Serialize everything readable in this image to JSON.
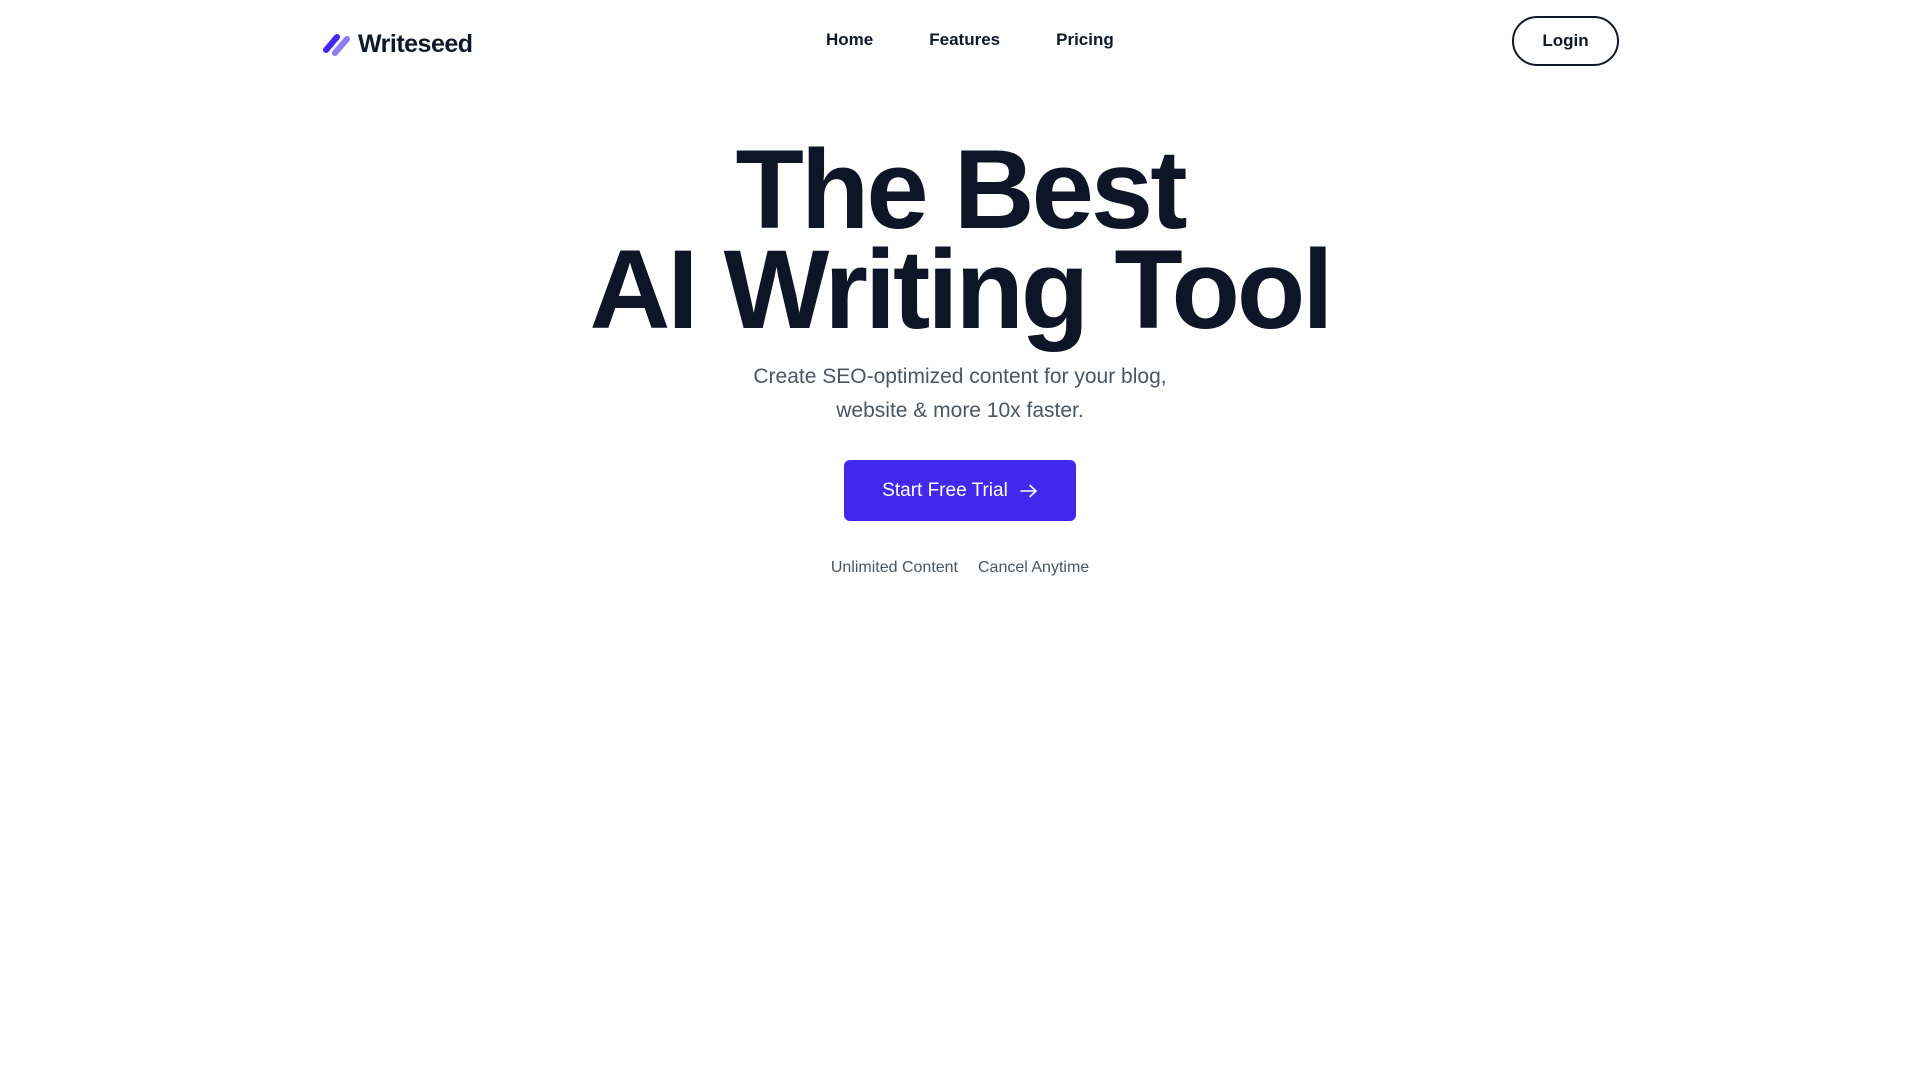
{
  "brand": {
    "name": "Writeseed",
    "logo_icon": "pen-stroke-icon",
    "accent_color": "#4328f0"
  },
  "nav": {
    "items": [
      {
        "label": "Home"
      },
      {
        "label": "Features"
      },
      {
        "label": "Pricing"
      }
    ],
    "login_label": "Login"
  },
  "hero": {
    "title_line1": "The Best",
    "title_line2": "AI Writing Tool",
    "subtitle_line1": "Create SEO-optimized content for your blog,",
    "subtitle_line2": "website & more 10x faster.",
    "cta_label": "Start Free Trial",
    "cta_icon": "arrow-right-icon",
    "perks": [
      "Unlimited Content",
      "Cancel Anytime"
    ]
  }
}
